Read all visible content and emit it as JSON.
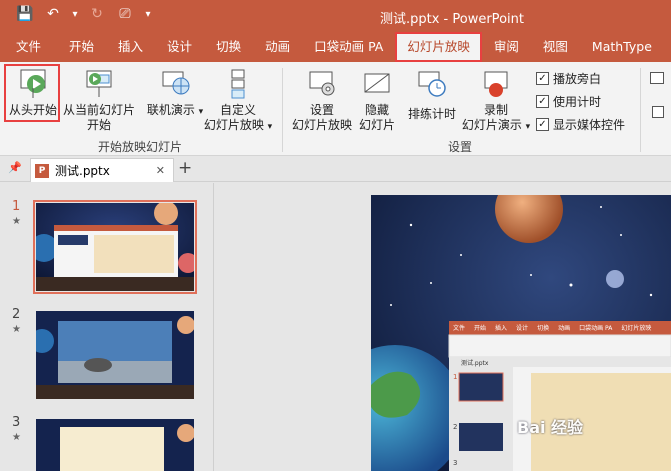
{
  "titlebar": {
    "title": "测试.pptx - PowerPoint",
    "qat": {
      "save": "💾",
      "undo": "↶",
      "undo_dropdown": "▾",
      "redo": "↻",
      "present": "⎚",
      "customize": "▾"
    }
  },
  "tabs": [
    {
      "label": "文件"
    },
    {
      "label": "开始"
    },
    {
      "label": "插入"
    },
    {
      "label": "设计"
    },
    {
      "label": "切换"
    },
    {
      "label": "动画"
    },
    {
      "label": "口袋动画 PA"
    },
    {
      "label": "幻灯片放映",
      "active": true
    },
    {
      "label": "审阅"
    },
    {
      "label": "视图"
    },
    {
      "label": "MathType"
    }
  ],
  "ribbon": {
    "start_group": {
      "label": "开始放映幻灯片",
      "from_beginning": "从头开始",
      "from_current_line1": "从当前幻灯片",
      "from_current_line2": "开始",
      "online_present": "联机演示",
      "online_present_arrow": "▾",
      "custom_line1": "自定义",
      "custom_line2": "幻灯片放映",
      "custom_arrow": "▾"
    },
    "setup_group": {
      "label": "设置",
      "setup_line1": "设置",
      "setup_line2": "幻灯片放映",
      "hide_line1": "隐藏",
      "hide_line2": "幻灯片",
      "rehearse": "排练计时",
      "record_line1": "录制",
      "record_line2": "幻灯片演示",
      "record_arrow": "▾",
      "checkboxes": [
        {
          "label": "播放旁白",
          "checked": true
        },
        {
          "label": "使用计时",
          "checked": true
        },
        {
          "label": "显示媒体控件",
          "checked": true
        }
      ]
    }
  },
  "docbar": {
    "tab_label": "测试.pptx",
    "pin": "📌",
    "close": "✕",
    "add": "+"
  },
  "thumbnails": [
    {
      "number": "1",
      "star": "★",
      "selected": true
    },
    {
      "number": "2",
      "star": "★",
      "selected": false
    },
    {
      "number": "3",
      "star": "★",
      "selected": false
    }
  ],
  "inner_screenshot": {
    "tabs": [
      "文件",
      "开始",
      "插入",
      "设计",
      "切换",
      "动画",
      "口袋动画 PA",
      "幻灯片放映"
    ],
    "doc_tab": "测试.pptx",
    "thumb_numbers": [
      "1",
      "2",
      "3"
    ]
  },
  "watermark": "Bai 经验"
}
